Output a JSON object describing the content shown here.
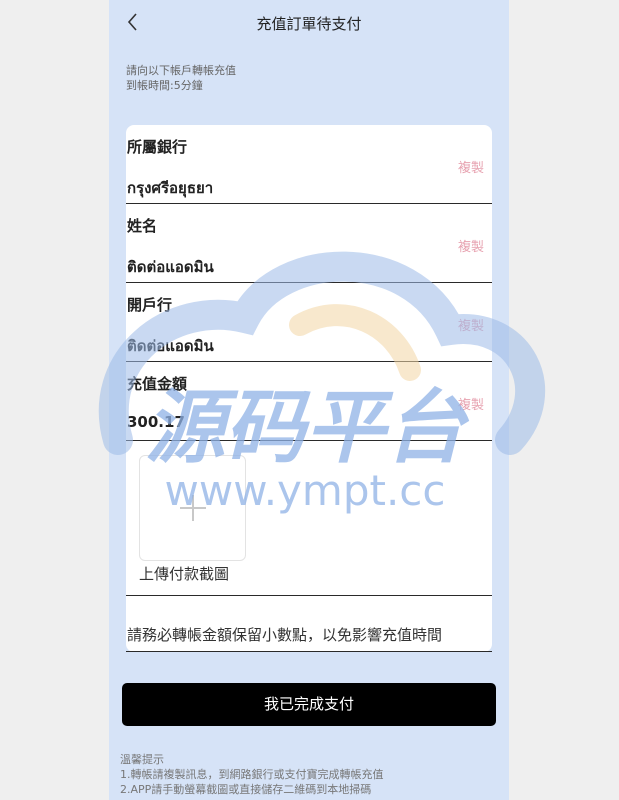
{
  "header": {
    "title": "充值訂單待支付"
  },
  "intro": {
    "line1": "請向以下帳戶轉帳充值",
    "line2": "到帳時間:5分鐘"
  },
  "fields": [
    {
      "label": "所屬銀行",
      "value": "กรุงศรีอยุธยา",
      "copy": "複製"
    },
    {
      "label": "姓名",
      "value": "ติดต่อแอดมิน",
      "copy": "複製"
    },
    {
      "label": "開戶行",
      "value": "ติดต่อแอดมิน",
      "copy": "複製"
    },
    {
      "label": "充值金額",
      "value": "300.17",
      "copy": "複製"
    }
  ],
  "upload": {
    "label": "上傳付款截圖"
  },
  "notice": "請務必轉帳金額保留小數點，以免影響充值時間",
  "submit": {
    "label": "我已完成支付"
  },
  "tips": {
    "title": "溫馨提示",
    "line1": "1.轉帳請複製訊息，到網路銀行或支付寶完成轉帳充值",
    "line2": "2.APP請手動螢幕截圖或直接儲存二維碼到本地掃碼"
  },
  "watermark": {
    "text_main": "源码平台",
    "text_url": "www.ympt.cc"
  },
  "colors": {
    "page_bg": "#d6e3f7",
    "copy_text": "#e7a2b0",
    "button_bg": "#000000"
  }
}
